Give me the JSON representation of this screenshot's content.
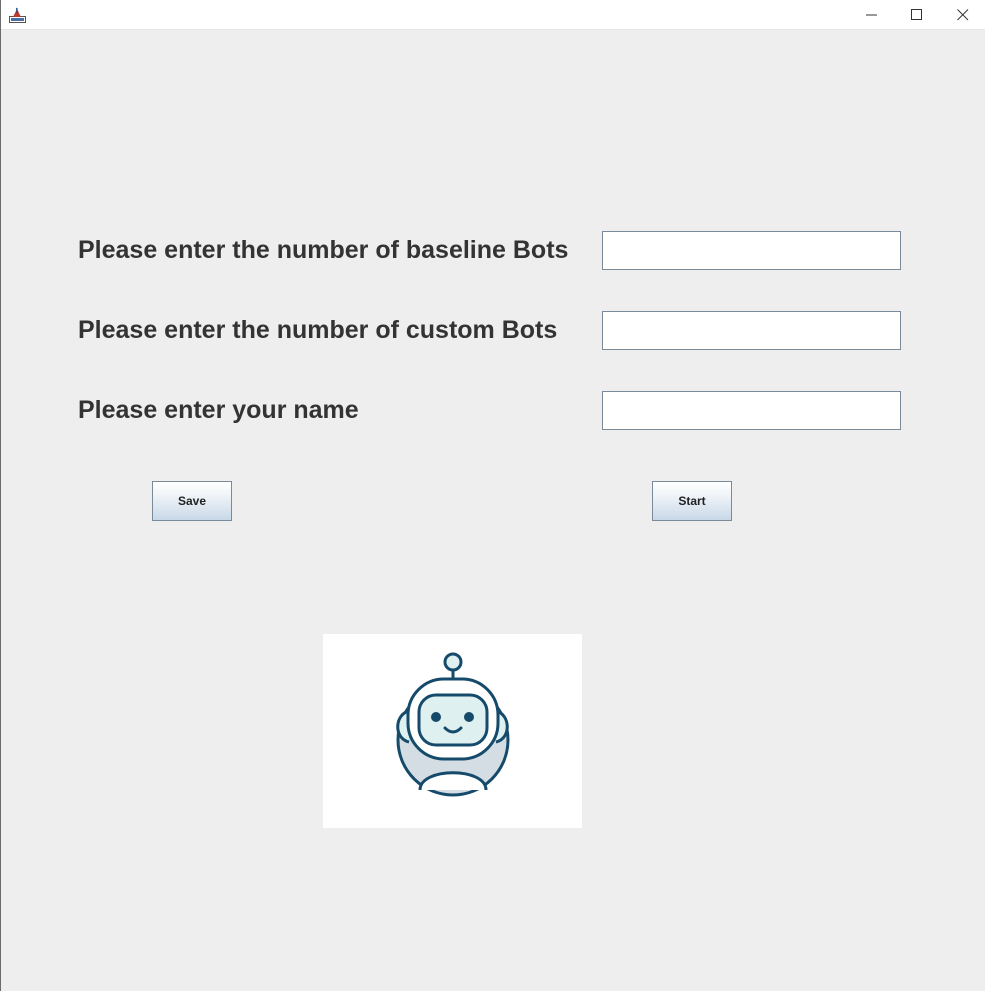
{
  "window": {
    "title": "",
    "controls": {
      "minimize_icon": "minimize-icon",
      "maximize_icon": "maximize-icon",
      "close_icon": "close-icon"
    }
  },
  "form": {
    "baseline_bots": {
      "label": "Please enter the number of baseline Bots",
      "value": "",
      "placeholder": ""
    },
    "custom_bots": {
      "label": "Please enter the number of custom Bots",
      "value": "",
      "placeholder": ""
    },
    "name": {
      "label": "Please enter your name",
      "value": "",
      "placeholder": ""
    }
  },
  "buttons": {
    "save_label": "Save",
    "start_label": "Start"
  },
  "image": {
    "icon": "robot-icon",
    "colors": {
      "outline": "#154a6b",
      "face_fill": "#dff0f0",
      "body_fill": "#d4dde3",
      "background": "#ffffff"
    }
  },
  "theme": {
    "window_bg": "#eeeeee",
    "label_color": "#333333",
    "button_gradient_bottom": "#c8d8e8"
  }
}
